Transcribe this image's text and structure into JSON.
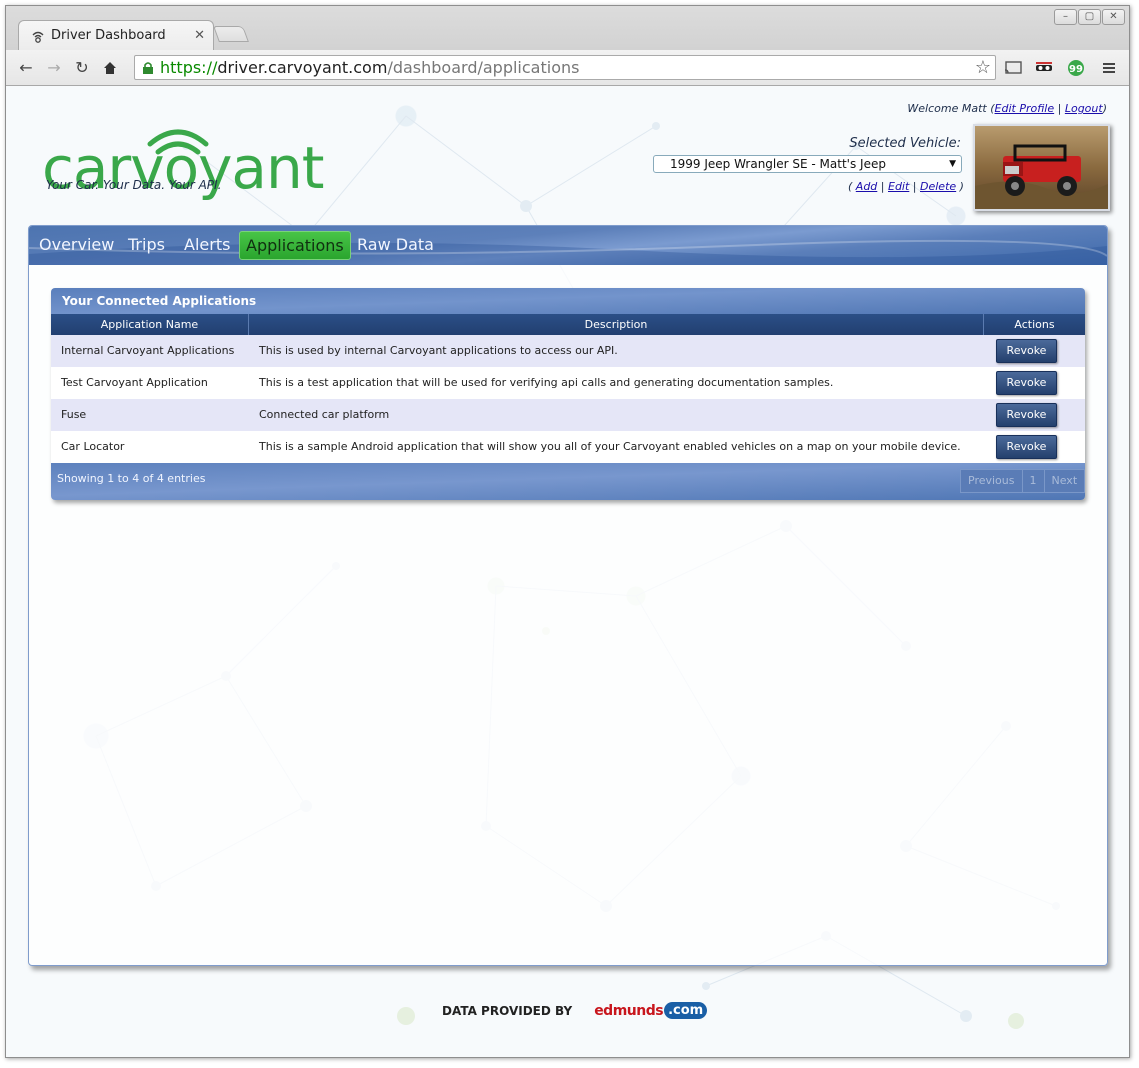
{
  "browser": {
    "tab_title": "Driver Dashboard",
    "url_scheme": "https://",
    "url_host": "driver.carvoyant.com",
    "url_path": "/dashboard/applications"
  },
  "header": {
    "welcome_prefix": "Welcome Matt (",
    "edit_profile": "Edit Profile",
    "separator": " | ",
    "logout": "Logout",
    "welcome_suffix": ")",
    "logo_text": "carvoyant",
    "tagline": "Your Car. Your Data. Your API.",
    "selected_vehicle_label": "Selected Vehicle:",
    "selected_vehicle": "1999 Jeep Wrangler SE - Matt's Jeep",
    "vehicle_links_open": "( ",
    "add": "Add",
    "edit": "Edit",
    "delete": "Delete",
    "vehicle_links_close": " )"
  },
  "nav": {
    "items": [
      "Overview",
      "Trips",
      "Alerts",
      "Applications",
      "Raw Data"
    ],
    "active": "Applications"
  },
  "apps_table": {
    "title": "Your Connected Applications",
    "columns": [
      "Application Name",
      "Description",
      "Actions"
    ],
    "rows": [
      {
        "name": "Internal Carvoyant Applications",
        "description": "This is used by internal Carvoyant applications to access our API.",
        "action": "Revoke"
      },
      {
        "name": "Test Carvoyant Application",
        "description": "This is a test application that will be used for verifying api calls and generating documentation samples.",
        "action": "Revoke"
      },
      {
        "name": "Fuse",
        "description": "Connected car platform",
        "action": "Revoke"
      },
      {
        "name": "Car Locator",
        "description": "This is a sample Android application that will show you all of your Carvoyant enabled vehicles on a map on your mobile device.",
        "action": "Revoke"
      }
    ],
    "showing": "Showing 1 to 4 of 4 entries",
    "pager": {
      "previous": "Previous",
      "page": "1",
      "next": "Next"
    }
  },
  "footer": {
    "provided_by": "DATA PROVIDED BY",
    "partner_word": "edmunds",
    "partner_com": ".com"
  },
  "colors": {
    "nav_blue": "#5a7fbc",
    "active_green": "#2aa52e",
    "header_dark": "#223f70",
    "row_alt": "#e5e6f7",
    "logo_green": "#3aa84a",
    "logo_navy": "#1d2d4a"
  }
}
